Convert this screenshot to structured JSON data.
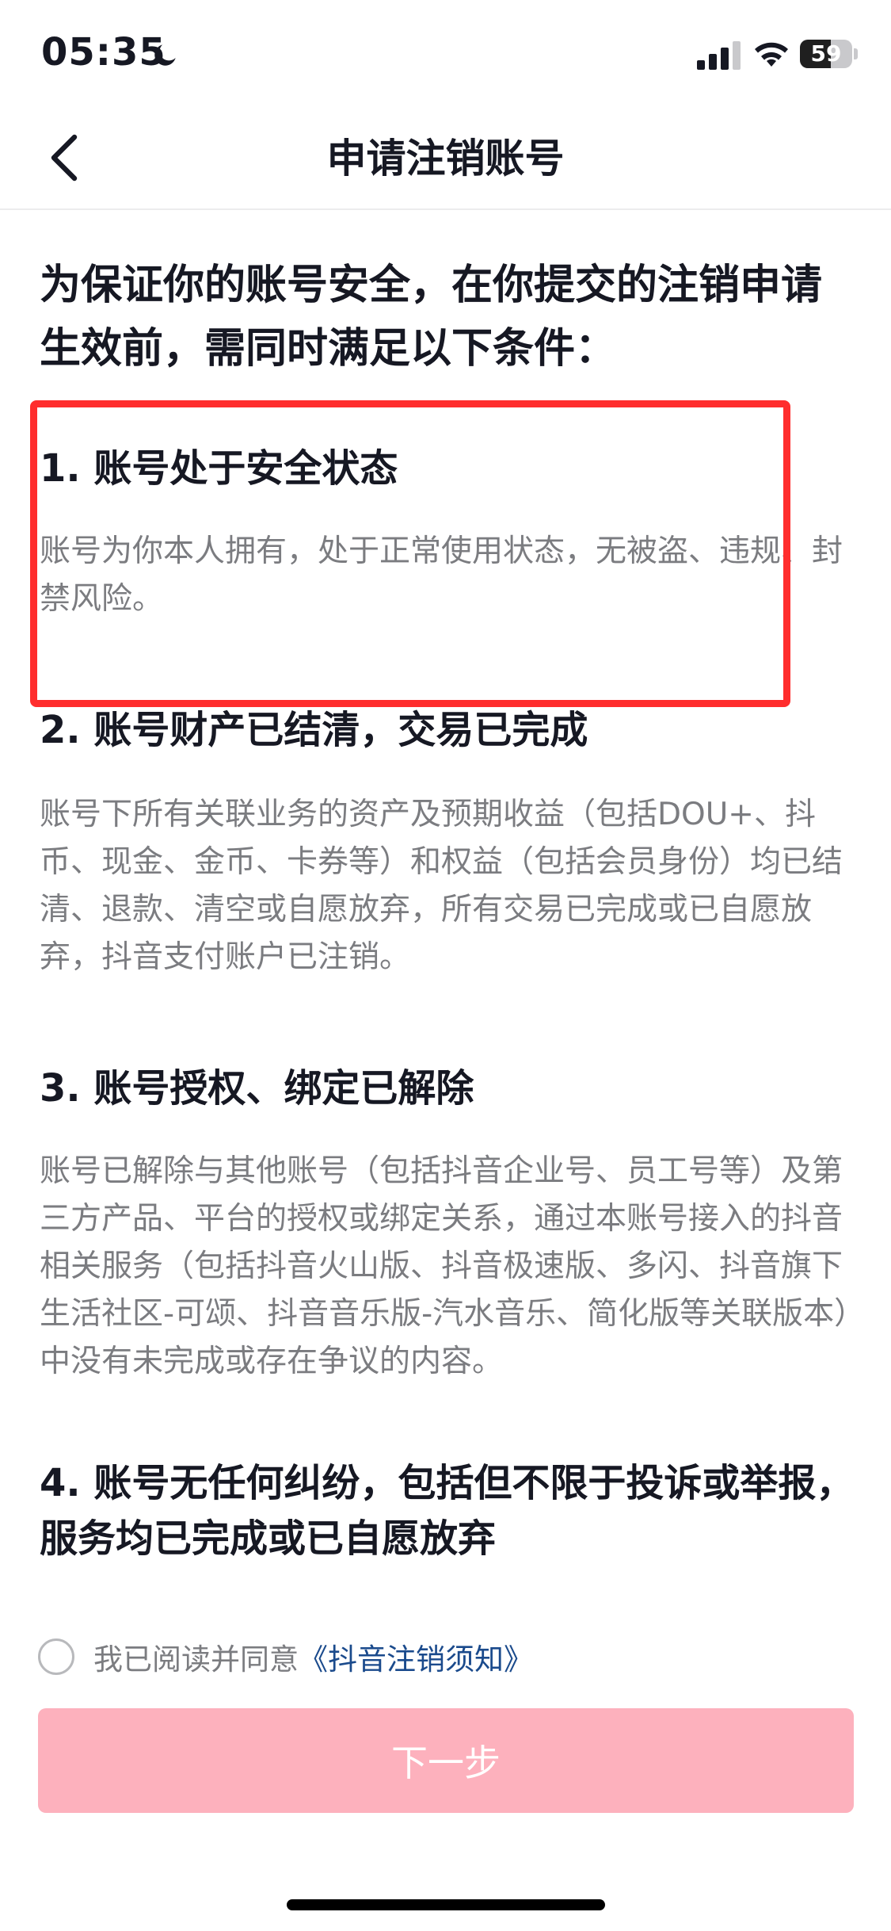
{
  "status_bar": {
    "time": "05:35",
    "battery_level": "59",
    "battery_fraction": 0.59
  },
  "nav": {
    "title": "申请注销账号"
  },
  "intro": "为保证你的账号安全，在你提交的注销申请生效前，需同时满足以下条件：",
  "sections": [
    {
      "title": "1. 账号处于安全状态",
      "body": "账号为你本人拥有，处于正常使用状态，无被盗、违规、封禁风险。"
    },
    {
      "title": "2. 账号财产已结清，交易已完成",
      "body": "账号下所有关联业务的资产及预期收益（包括DOU+、抖币、现金、金币、卡券等）和权益（包括会员身份）均已结清、退款、清空或自愿放弃，所有交易已完成或已自愿放弃，抖音支付账户已注销。"
    },
    {
      "title": "3. 账号授权、绑定已解除",
      "body": "账号已解除与其他账号（包括抖音企业号、员工号等）及第三方产品、平台的授权或绑定关系，通过本账号接入的抖音相关服务（包括抖音火山版、抖音极速版、多闪、抖音旗下生活社区-可颂、抖音音乐版-汽水音乐、简化版等关联版本）中没有未完成或存在争议的内容。"
    },
    {
      "title": "4. 账号无任何纠纷，包括但不限于投诉或举报，服务均已完成或已自愿放弃",
      "body": ""
    }
  ],
  "agreement": {
    "text": "我已阅读并同意",
    "link": "《抖音注销须知》",
    "checked": false
  },
  "next_button": {
    "label": "下一步"
  },
  "colors": {
    "highlight_border": "#ff2d2d",
    "button_disabled": "#fdb1bd",
    "link": "#1a4a8c",
    "body_text": "#7b7c80"
  }
}
